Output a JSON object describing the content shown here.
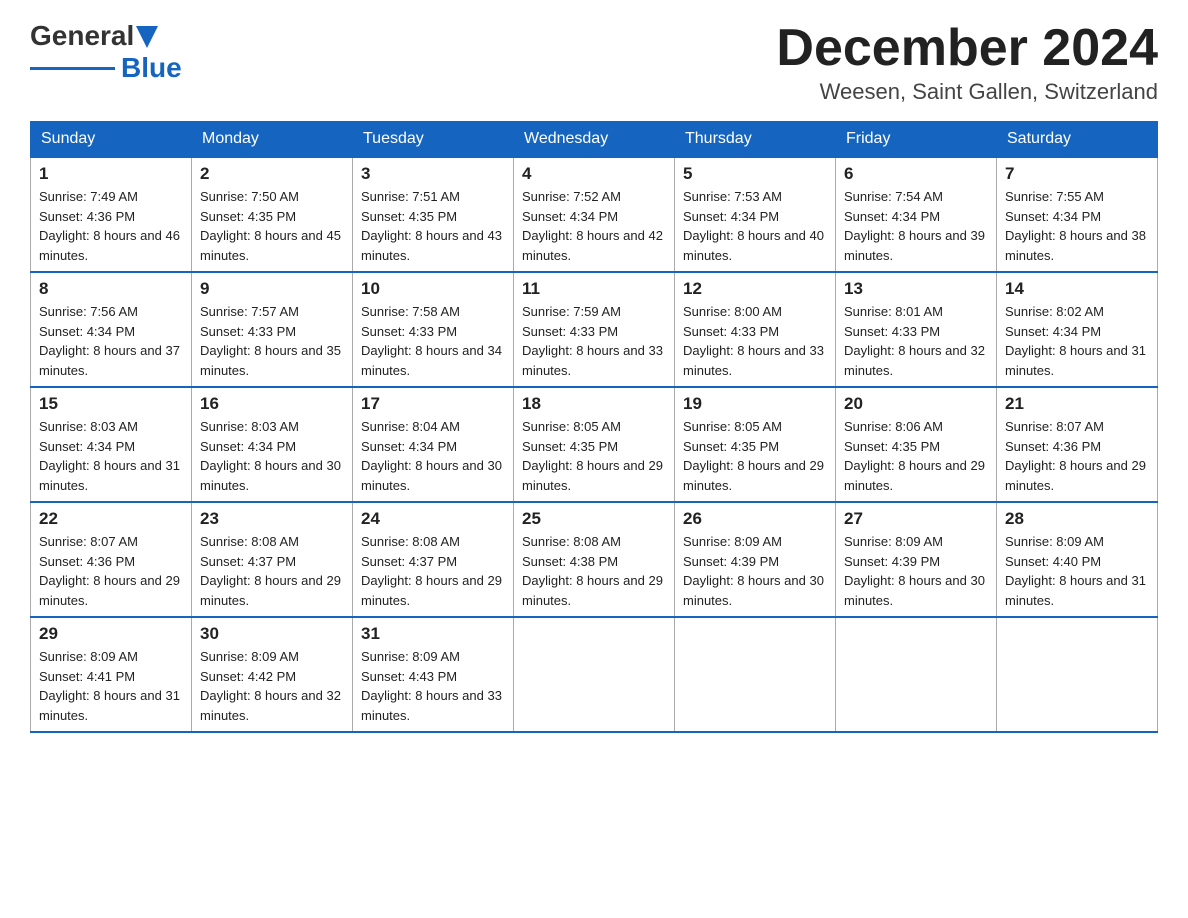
{
  "header": {
    "logo": {
      "general": "General",
      "blue": "Blue"
    },
    "title": "December 2024",
    "location": "Weesen, Saint Gallen, Switzerland"
  },
  "calendar": {
    "days_of_week": [
      "Sunday",
      "Monday",
      "Tuesday",
      "Wednesday",
      "Thursday",
      "Friday",
      "Saturday"
    ],
    "weeks": [
      [
        {
          "day": "1",
          "sunrise": "7:49 AM",
          "sunset": "4:36 PM",
          "daylight": "8 hours and 46 minutes."
        },
        {
          "day": "2",
          "sunrise": "7:50 AM",
          "sunset": "4:35 PM",
          "daylight": "8 hours and 45 minutes."
        },
        {
          "day": "3",
          "sunrise": "7:51 AM",
          "sunset": "4:35 PM",
          "daylight": "8 hours and 43 minutes."
        },
        {
          "day": "4",
          "sunrise": "7:52 AM",
          "sunset": "4:34 PM",
          "daylight": "8 hours and 42 minutes."
        },
        {
          "day": "5",
          "sunrise": "7:53 AM",
          "sunset": "4:34 PM",
          "daylight": "8 hours and 40 minutes."
        },
        {
          "day": "6",
          "sunrise": "7:54 AM",
          "sunset": "4:34 PM",
          "daylight": "8 hours and 39 minutes."
        },
        {
          "day": "7",
          "sunrise": "7:55 AM",
          "sunset": "4:34 PM",
          "daylight": "8 hours and 38 minutes."
        }
      ],
      [
        {
          "day": "8",
          "sunrise": "7:56 AM",
          "sunset": "4:34 PM",
          "daylight": "8 hours and 37 minutes."
        },
        {
          "day": "9",
          "sunrise": "7:57 AM",
          "sunset": "4:33 PM",
          "daylight": "8 hours and 35 minutes."
        },
        {
          "day": "10",
          "sunrise": "7:58 AM",
          "sunset": "4:33 PM",
          "daylight": "8 hours and 34 minutes."
        },
        {
          "day": "11",
          "sunrise": "7:59 AM",
          "sunset": "4:33 PM",
          "daylight": "8 hours and 33 minutes."
        },
        {
          "day": "12",
          "sunrise": "8:00 AM",
          "sunset": "4:33 PM",
          "daylight": "8 hours and 33 minutes."
        },
        {
          "day": "13",
          "sunrise": "8:01 AM",
          "sunset": "4:33 PM",
          "daylight": "8 hours and 32 minutes."
        },
        {
          "day": "14",
          "sunrise": "8:02 AM",
          "sunset": "4:34 PM",
          "daylight": "8 hours and 31 minutes."
        }
      ],
      [
        {
          "day": "15",
          "sunrise": "8:03 AM",
          "sunset": "4:34 PM",
          "daylight": "8 hours and 31 minutes."
        },
        {
          "day": "16",
          "sunrise": "8:03 AM",
          "sunset": "4:34 PM",
          "daylight": "8 hours and 30 minutes."
        },
        {
          "day": "17",
          "sunrise": "8:04 AM",
          "sunset": "4:34 PM",
          "daylight": "8 hours and 30 minutes."
        },
        {
          "day": "18",
          "sunrise": "8:05 AM",
          "sunset": "4:35 PM",
          "daylight": "8 hours and 29 minutes."
        },
        {
          "day": "19",
          "sunrise": "8:05 AM",
          "sunset": "4:35 PM",
          "daylight": "8 hours and 29 minutes."
        },
        {
          "day": "20",
          "sunrise": "8:06 AM",
          "sunset": "4:35 PM",
          "daylight": "8 hours and 29 minutes."
        },
        {
          "day": "21",
          "sunrise": "8:07 AM",
          "sunset": "4:36 PM",
          "daylight": "8 hours and 29 minutes."
        }
      ],
      [
        {
          "day": "22",
          "sunrise": "8:07 AM",
          "sunset": "4:36 PM",
          "daylight": "8 hours and 29 minutes."
        },
        {
          "day": "23",
          "sunrise": "8:08 AM",
          "sunset": "4:37 PM",
          "daylight": "8 hours and 29 minutes."
        },
        {
          "day": "24",
          "sunrise": "8:08 AM",
          "sunset": "4:37 PM",
          "daylight": "8 hours and 29 minutes."
        },
        {
          "day": "25",
          "sunrise": "8:08 AM",
          "sunset": "4:38 PM",
          "daylight": "8 hours and 29 minutes."
        },
        {
          "day": "26",
          "sunrise": "8:09 AM",
          "sunset": "4:39 PM",
          "daylight": "8 hours and 30 minutes."
        },
        {
          "day": "27",
          "sunrise": "8:09 AM",
          "sunset": "4:39 PM",
          "daylight": "8 hours and 30 minutes."
        },
        {
          "day": "28",
          "sunrise": "8:09 AM",
          "sunset": "4:40 PM",
          "daylight": "8 hours and 31 minutes."
        }
      ],
      [
        {
          "day": "29",
          "sunrise": "8:09 AM",
          "sunset": "4:41 PM",
          "daylight": "8 hours and 31 minutes."
        },
        {
          "day": "30",
          "sunrise": "8:09 AM",
          "sunset": "4:42 PM",
          "daylight": "8 hours and 32 minutes."
        },
        {
          "day": "31",
          "sunrise": "8:09 AM",
          "sunset": "4:43 PM",
          "daylight": "8 hours and 33 minutes."
        },
        null,
        null,
        null,
        null
      ]
    ]
  }
}
